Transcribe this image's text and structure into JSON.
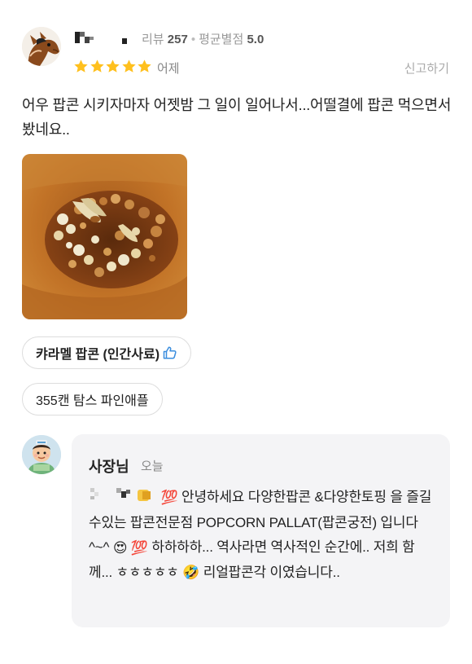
{
  "review": {
    "review_count_label": "리뷰",
    "review_count": "257",
    "avg_rating_label": "평균별점",
    "avg_rating": "5.0",
    "stars": 5,
    "date": "어제",
    "report_label": "신고하기",
    "content": "어우 팝콘 시키자마자 어젯밤 그 일이 일어나서...어떨결에 팝콘 먹으면서 봤네요..",
    "menu_items": [
      {
        "name": "캬라멜 팝콘 (인간사료)",
        "recommended": true
      },
      {
        "name": "355캔 탐스 파인애플",
        "recommended": false
      }
    ]
  },
  "reply": {
    "author": "사장님",
    "time": "오늘",
    "text": "안녕하세요 다양한팝콘 &다양한토핑 을 즐길수있는 팝콘전문점 POPCORN PALLAT(팝콘궁전) 입니다 ^~^",
    "text2": "하하하하... 역사라면 역사적인 순간에.. 저희 함께... ㅎㅎㅎㅎㅎ",
    "text3": "리얼팝콘각 이였습니다..",
    "emoji_100": "💯",
    "emoji_heart_eyes": "😍",
    "emoji_rofl": "🤣"
  },
  "colors": {
    "star": "#FFC01E",
    "thumb": "#3A8DDE",
    "reply_bg": "#F4F4F6"
  },
  "icons": [
    "horse-avatar",
    "star-icon",
    "thumbs-up-icon",
    "owner-avatar"
  ]
}
